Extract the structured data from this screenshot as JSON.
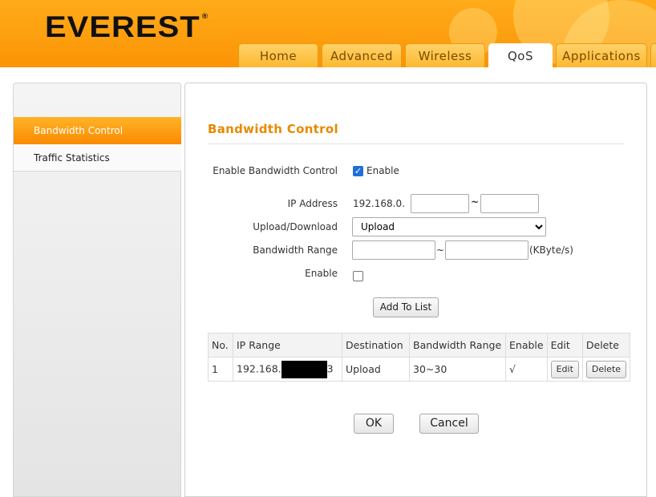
{
  "brand": {
    "logo_text": "EVEREST",
    "registered": "®"
  },
  "nav": {
    "tabs": [
      {
        "label": "Home"
      },
      {
        "label": "Advanced"
      },
      {
        "label": "Wireless"
      },
      {
        "label": "QoS"
      },
      {
        "label": "Applications"
      }
    ],
    "active_tab": "QoS"
  },
  "sidebar": {
    "items": [
      {
        "label": "Bandwidth Control",
        "active": true
      },
      {
        "label": "Traffic Statistics",
        "active": false
      }
    ]
  },
  "page": {
    "title": "Bandwidth Control",
    "enable_bw_label": "Enable Bandwidth Control",
    "enable_bw_checked": true,
    "enable_bw_text": "Enable",
    "ip_label": "IP Address",
    "ip_prefix": "192.168.0.",
    "ip_sep": "~",
    "ip_start": "",
    "ip_end": "",
    "updown_label": "Upload/Download",
    "updown_value": "Upload",
    "range_label": "Bandwidth Range",
    "range_sep": "~",
    "range_min": "",
    "range_max": "",
    "range_unit": "(KByte/s)",
    "enable_label": "Enable",
    "enable_checked": false,
    "add_button": "Add To List"
  },
  "table": {
    "headers": [
      "No.",
      "IP Range",
      "Destination",
      "Bandwidth Range",
      "Enable",
      "Edit",
      "Delete"
    ],
    "rows": [
      {
        "no": "1",
        "ip_prefix": "192.168.",
        "ip_suffix": "3",
        "destination": "Upload",
        "range": "30~30",
        "enable": "√",
        "edit": "Edit",
        "delete": "Delete"
      }
    ]
  },
  "actions": {
    "ok": "OK",
    "cancel": "Cancel"
  },
  "colors": {
    "accent": "#fb9405",
    "title": "#e68a00",
    "checkbox": "#1f6fd6"
  }
}
